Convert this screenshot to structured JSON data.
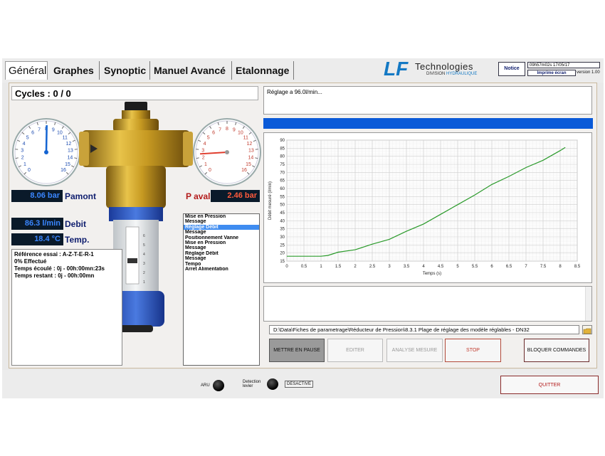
{
  "tabs": [
    "Général",
    "Graphes",
    "Synoptic",
    "Manuel Avancé",
    "Etalonnage"
  ],
  "brand": {
    "lf": "LF",
    "name": "Technologies",
    "division_prefix": "DIVISION",
    "division_highlight": "HYDRAULIQUE"
  },
  "header": {
    "notice": "Notice",
    "datetime": "09h57m02s 17/05/17",
    "print_label": "Imprime écran",
    "version": "version 1.00"
  },
  "cycles": "Cycles : 0 / 0",
  "left_gauge_labels": [
    "0",
    "1",
    "2",
    "3",
    "4",
    "5",
    "6",
    "7",
    "8",
    "9",
    "10",
    "11",
    "12",
    "13",
    "14",
    "15",
    "16"
  ],
  "right_gauge_labels": [
    "0",
    "1",
    "2",
    "3",
    "4",
    "5",
    "6",
    "7",
    "8",
    "9",
    "10",
    "11",
    "12",
    "13",
    "14",
    "15",
    "16"
  ],
  "pamont": {
    "value": "8.06 bar",
    "label": "Pamont",
    "gauge": 8.06
  },
  "paval": {
    "value": "2.46 bar",
    "label": "P aval",
    "gauge": 2.46
  },
  "debit": {
    "value": "86.3 l/min",
    "label": "Debit"
  },
  "temp": {
    "value": "18.4 °C",
    "label": "Temp."
  },
  "info": {
    "ref": "Référence essai : A-Z-T-E-R-1",
    "effectue": "0%  Effectué",
    "ecoule": "Temps écoulé : 0j - 00h:00mn:23s",
    "restant": "Temps restant : 0j - 00h:00mn"
  },
  "steps": [
    "Mise en Pression",
    "Message",
    "Réglage Débit",
    "Message",
    "Positionnement Vanne",
    "Mise en Pression",
    "Message",
    "Réglage Débit",
    "Message",
    "Tempo",
    "Arret Alimentation"
  ],
  "selected_step": 2,
  "message": "Réglage a 96.0l/min...",
  "path": "D:\\Data\\Fiches de parametrage\\Réducteur de Pression\\8.3.1 Plage de réglage des modèle réglables - DN32",
  "buttons": {
    "pause": "METTRE EN PAUSE",
    "edit": "EDITER",
    "analyse": "ANALYSE MESURE",
    "stop": "STOP",
    "block": "BLOQUER COMMANDES",
    "quit": "QUITTER"
  },
  "bottom": {
    "aru": "ARU",
    "detection": "Detection levier",
    "desactive": "DESACTIVE"
  },
  "colors": {
    "accent": "#0a5ad8",
    "curve": "#2a9a2a",
    "stop": "#c0392b"
  },
  "chart_data": {
    "type": "line",
    "xlabel": "Temps (s)",
    "ylabel": "Débit mesuré (l/min)",
    "xlim": [
      0,
      8.5
    ],
    "ylim": [
      15,
      90
    ],
    "xticks": [
      "0",
      "0.5",
      "1",
      "1.5",
      "2",
      "2.5",
      "3",
      "3.5",
      "4",
      "4.5",
      "5",
      "5.5",
      "6",
      "6.5",
      "7",
      "7.5",
      "8",
      "8.5"
    ],
    "yticks": [
      "15",
      "20",
      "25",
      "30",
      "35",
      "40",
      "45",
      "50",
      "55",
      "60",
      "65",
      "70",
      "75",
      "80",
      "85",
      "90"
    ],
    "grid": true,
    "x": [
      0,
      0.5,
      1,
      1.2,
      1.5,
      2,
      2.5,
      3,
      3.5,
      4,
      4.5,
      5,
      5.5,
      6,
      6.5,
      7,
      7.5,
      8,
      8.15
    ],
    "y": [
      18,
      18,
      18,
      18.5,
      20.5,
      22,
      25.5,
      28.5,
      33.5,
      38,
      44,
      50,
      56,
      62.5,
      67.5,
      73,
      77.5,
      83.5,
      85.5
    ]
  }
}
